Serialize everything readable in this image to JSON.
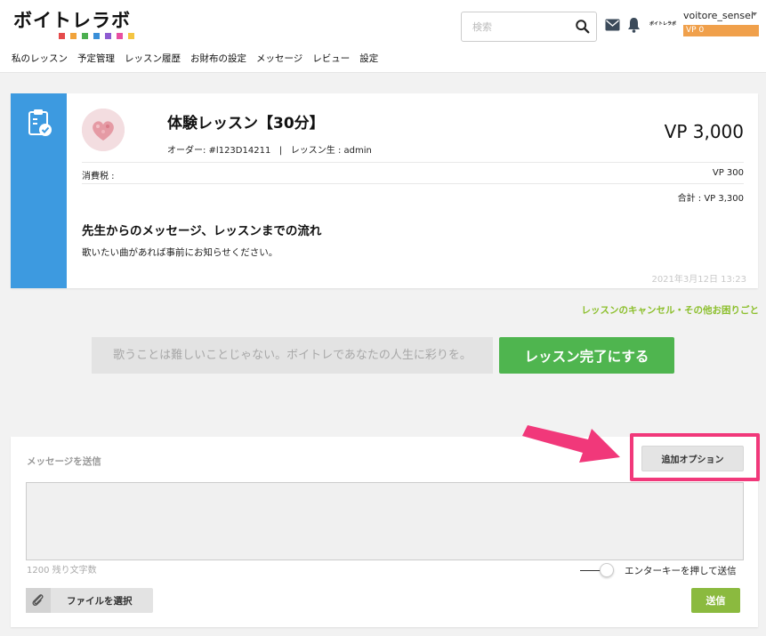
{
  "header": {
    "logo_text": "ボイトレラボ",
    "logo_dot_colors": [
      "#e54b4b",
      "#f1a33b",
      "#4caf50",
      "#3a8fd8",
      "#8e5bd1",
      "#e84fa1",
      "#f4c542"
    ],
    "search_placeholder": "検索",
    "mini_logo": "ボイトレラボ",
    "user_name": "voitore_sensei",
    "vp_badge": "VP 0"
  },
  "nav": {
    "items": [
      "私のレッスン",
      "予定管理",
      "レッスン履歴",
      "お財布の設定",
      "メッセージ",
      "レビュー",
      "設定"
    ]
  },
  "order": {
    "title": "体験レッスン【30分】",
    "order_label": "オーダー: #l123D14211",
    "separator": "|",
    "student_label": "レッスン生 : admin",
    "price": "VP 3,000",
    "tax_label": "消費税 :",
    "tax_value": "VP 300",
    "total": "合計 :  VP 3,300",
    "message_heading": "先生からのメッセージ、レッスンまでの流れ",
    "message_body": "歌いたい曲があれば事前にお知らせください。",
    "date": "2021年3月12日 13:23",
    "accent_color": "#3d9ae0"
  },
  "help_link": "レッスンのキャンセル・その他お困りごと",
  "motto": "歌うことは難しいことじゃない。ボイトレであなたの人生に彩りを。",
  "complete_button": "レッスン完了にする",
  "composer": {
    "title": "メッセージを送信",
    "option_button": "追加オプション",
    "message_value": "",
    "char_count": "1200 残り文字数",
    "enter_label": "エンターキーを押して送信",
    "file_button": "ファイルを選択",
    "send_button": "送信",
    "highlight_color": "#f1387a"
  }
}
